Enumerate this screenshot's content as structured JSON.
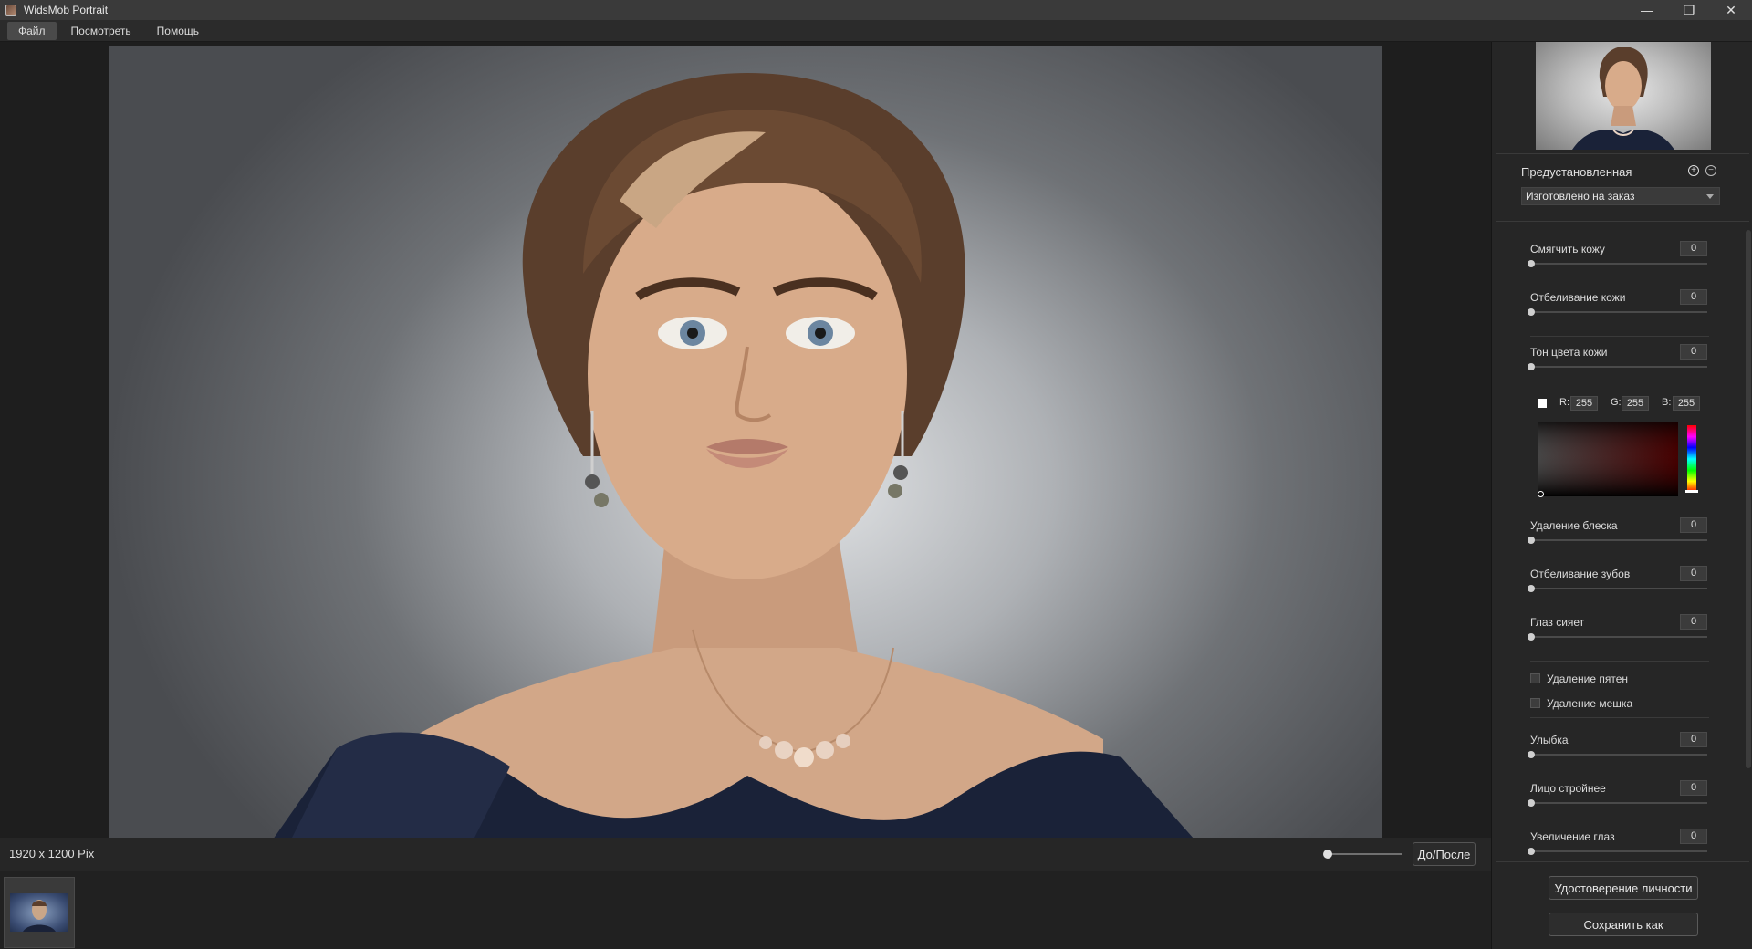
{
  "window": {
    "title": "WidsMob Portrait",
    "minimize_glyph": "—",
    "restore_glyph": "❐",
    "close_glyph": "✕"
  },
  "menu": [
    {
      "label": "Файл",
      "active": true
    },
    {
      "label": "Посмотреть",
      "active": false
    },
    {
      "label": "Помощь",
      "active": false
    }
  ],
  "status": {
    "dimensions": "1920 x 1200 Pix",
    "zoom_level": 0.0,
    "before_after_label": "До/После"
  },
  "panel": {
    "preset_label": "Предустановленная",
    "preset_add_glyph": "+",
    "preset_remove_glyph": "−",
    "preset_value": "Изготовлено на заказ",
    "sliders": [
      {
        "label": "Смягчить кожу",
        "value": "0"
      },
      {
        "label": "Отбеливание кожи",
        "value": "0"
      },
      {
        "label": "Тон цвета кожи",
        "value": "0"
      },
      {
        "label": "Удаление блеска",
        "value": "0"
      },
      {
        "label": "Отбеливание зубов",
        "value": "0"
      },
      {
        "label": "Глаз сияет",
        "value": "0"
      },
      {
        "label": "Улыбка",
        "value": "0"
      },
      {
        "label": "Лицо стройнее",
        "value": "0"
      },
      {
        "label": "Увеличение глаз",
        "value": "0"
      }
    ],
    "color": {
      "r_label": "R:",
      "r": "255",
      "g_label": "G:",
      "g": "255",
      "b_label": "B:",
      "b": "255",
      "swatch": "#ffffff"
    },
    "checkboxes": [
      {
        "label": "Удаление пятен",
        "checked": false
      },
      {
        "label": "Удаление мешка",
        "checked": false
      }
    ],
    "identity_button": "Удостоверение личности",
    "save_button": "Сохранить как"
  }
}
